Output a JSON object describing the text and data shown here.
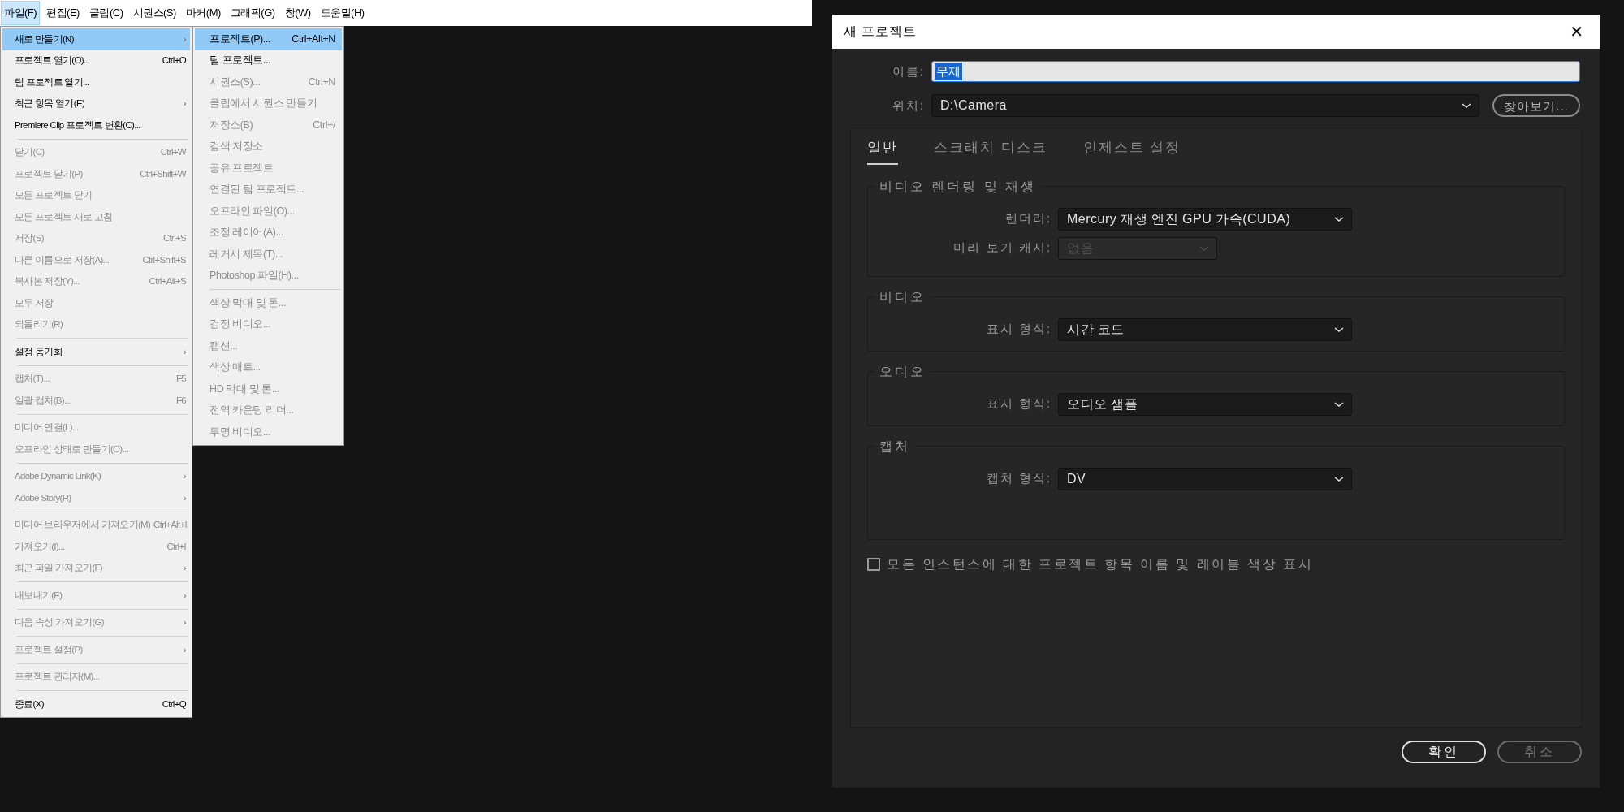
{
  "menu_bar": {
    "items": [
      {
        "label": "파일(F)",
        "selected": true
      },
      {
        "label": "편집(E)",
        "selected": false
      },
      {
        "label": "클립(C)",
        "selected": false
      },
      {
        "label": "시퀀스(S)",
        "selected": false
      },
      {
        "label": "마커(M)",
        "selected": false
      },
      {
        "label": "그래픽(G)",
        "selected": false
      },
      {
        "label": "창(W)",
        "selected": false
      },
      {
        "label": "도움말(H)",
        "selected": false
      }
    ]
  },
  "file_menu": {
    "items": [
      {
        "kind": "item",
        "label": "새로 만들기(N)",
        "arrow": "›",
        "selected": true,
        "disabled": false
      },
      {
        "kind": "item",
        "label": "프로젝트 열기(O)...",
        "shortcut": "Ctrl+O",
        "selected": false,
        "disabled": false
      },
      {
        "kind": "item",
        "label": "팀 프로젝트 열기...",
        "selected": false,
        "disabled": false
      },
      {
        "kind": "item",
        "label": "최근 항목 열기(E)",
        "arrow": "›",
        "selected": false,
        "disabled": false
      },
      {
        "kind": "item",
        "label": "Premiere Clip 프로젝트 변환(C)...",
        "selected": false,
        "disabled": false
      },
      {
        "kind": "separator"
      },
      {
        "kind": "item",
        "label": "닫기(C)",
        "shortcut": "Ctrl+W",
        "selected": false,
        "disabled": true
      },
      {
        "kind": "item",
        "label": "프로젝트 닫기(P)",
        "shortcut": "Ctrl+Shift+W",
        "selected": false,
        "disabled": true
      },
      {
        "kind": "item",
        "label": "모든 프로젝트 닫기",
        "selected": false,
        "disabled": true
      },
      {
        "kind": "item",
        "label": "모든 프로젝트 새로 고침",
        "selected": false,
        "disabled": true
      },
      {
        "kind": "item",
        "label": "저장(S)",
        "shortcut": "Ctrl+S",
        "selected": false,
        "disabled": true
      },
      {
        "kind": "item",
        "label": "다른 이름으로 저장(A)...",
        "shortcut": "Ctrl+Shift+S",
        "selected": false,
        "disabled": true
      },
      {
        "kind": "item",
        "label": "복사본 저장(Y)...",
        "shortcut": "Ctrl+Alt+S",
        "selected": false,
        "disabled": true
      },
      {
        "kind": "item",
        "label": "모두 저장",
        "selected": false,
        "disabled": true
      },
      {
        "kind": "item",
        "label": "되돌리기(R)",
        "selected": false,
        "disabled": true
      },
      {
        "kind": "separator"
      },
      {
        "kind": "item",
        "label": "설정 동기화",
        "arrow": "›",
        "selected": false,
        "disabled": false
      },
      {
        "kind": "separator"
      },
      {
        "kind": "item",
        "label": "캡처(T)...",
        "shortcut": "F5",
        "selected": false,
        "disabled": true
      },
      {
        "kind": "item",
        "label": "일괄 캡처(B)...",
        "shortcut": "F6",
        "selected": false,
        "disabled": true
      },
      {
        "kind": "separator"
      },
      {
        "kind": "item",
        "label": "미디어 연결(L)...",
        "selected": false,
        "disabled": true
      },
      {
        "kind": "item",
        "label": "오프라인 상태로 만들기(O)...",
        "selected": false,
        "disabled": true
      },
      {
        "kind": "separator"
      },
      {
        "kind": "item",
        "label": "Adobe Dynamic Link(K)",
        "arrow": "›",
        "selected": false,
        "disabled": true
      },
      {
        "kind": "item",
        "label": "Adobe Story(R)",
        "arrow": "›",
        "selected": false,
        "disabled": true
      },
      {
        "kind": "separator"
      },
      {
        "kind": "item",
        "label": "미디어 브라우저에서 가져오기(M)",
        "shortcut": "Ctrl+Alt+I",
        "selected": false,
        "disabled": true
      },
      {
        "kind": "item",
        "label": "가져오기(I)...",
        "shortcut": "Ctrl+I",
        "selected": false,
        "disabled": true
      },
      {
        "kind": "item",
        "label": "최근 파일 가져오기(F)",
        "arrow": "›",
        "selected": false,
        "disabled": true
      },
      {
        "kind": "separator"
      },
      {
        "kind": "item",
        "label": "내보내기(E)",
        "arrow": "›",
        "selected": false,
        "disabled": true
      },
      {
        "kind": "separator"
      },
      {
        "kind": "item",
        "label": "다음 속성 가져오기(G)",
        "arrow": "›",
        "selected": false,
        "disabled": true
      },
      {
        "kind": "separator"
      },
      {
        "kind": "item",
        "label": "프로젝트 설정(P)",
        "arrow": "›",
        "selected": false,
        "disabled": true
      },
      {
        "kind": "separator"
      },
      {
        "kind": "item",
        "label": "프로젝트 관리자(M)...",
        "selected": false,
        "disabled": true
      },
      {
        "kind": "separator"
      },
      {
        "kind": "item",
        "label": "종료(X)",
        "shortcut": "Ctrl+Q",
        "selected": false,
        "disabled": false
      }
    ]
  },
  "new_submenu": {
    "items": [
      {
        "kind": "item",
        "label": "프로젝트(P)...",
        "shortcut": "Ctrl+Alt+N",
        "selected": true,
        "disabled": false
      },
      {
        "kind": "item",
        "label": "팀 프로젝트...",
        "selected": false,
        "disabled": false
      },
      {
        "kind": "item",
        "label": "시퀀스(S)...",
        "shortcut": "Ctrl+N",
        "selected": false,
        "disabled": true
      },
      {
        "kind": "item",
        "label": "클립에서 시퀀스 만들기",
        "selected": false,
        "disabled": true
      },
      {
        "kind": "item",
        "label": "저장소(B)",
        "shortcut": "Ctrl+/",
        "selected": false,
        "disabled": true
      },
      {
        "kind": "item",
        "label": "검색 저장소",
        "selected": false,
        "disabled": true
      },
      {
        "kind": "item",
        "label": "공유 프로젝트",
        "selected": false,
        "disabled": true
      },
      {
        "kind": "item",
        "label": "연결된 팀 프로젝트...",
        "selected": false,
        "disabled": true
      },
      {
        "kind": "item",
        "label": "오프라인 파일(O)...",
        "selected": false,
        "disabled": true
      },
      {
        "kind": "item",
        "label": "조정 레이어(A)...",
        "selected": false,
        "disabled": true
      },
      {
        "kind": "item",
        "label": "레거시 제목(T)...",
        "selected": false,
        "disabled": true
      },
      {
        "kind": "item",
        "label": "Photoshop 파일(H)...",
        "selected": false,
        "disabled": true
      },
      {
        "kind": "separator"
      },
      {
        "kind": "item",
        "label": "색상 막대 및 톤...",
        "selected": false,
        "disabled": true
      },
      {
        "kind": "item",
        "label": "검정 비디오...",
        "selected": false,
        "disabled": true
      },
      {
        "kind": "item",
        "label": "캡션...",
        "selected": false,
        "disabled": true
      },
      {
        "kind": "item",
        "label": "색상 매트...",
        "selected": false,
        "disabled": true
      },
      {
        "kind": "item",
        "label": "HD 막대 및 톤...",
        "selected": false,
        "disabled": true
      },
      {
        "kind": "item",
        "label": "전역 카운팅 리더...",
        "selected": false,
        "disabled": true
      },
      {
        "kind": "item",
        "label": "투명 비디오...",
        "selected": false,
        "disabled": true
      }
    ]
  },
  "dialog": {
    "title": "새 프로젝트",
    "close": "✕",
    "name": {
      "label": "이름:",
      "value": "무제",
      "selected": true
    },
    "location": {
      "label": "위치:",
      "value": "D:\\Camera"
    },
    "browse_button": "찾아보기...",
    "tabs": [
      {
        "label": "일반",
        "selected": true
      },
      {
        "label": "스크래치 디스크",
        "selected": false
      },
      {
        "label": "인제스트 설정",
        "selected": false
      }
    ],
    "groups": [
      {
        "title": "비디오 렌더링 및 재생",
        "fields": [
          {
            "label": "렌더러:",
            "value": "Mercury 재생 엔진 GPU 가속(CUDA)",
            "disabled": false
          },
          {
            "label": "미리 보기 캐시:",
            "value": "없음",
            "disabled": true
          }
        ]
      },
      {
        "title": "비디오",
        "fields": [
          {
            "label": "표시 형식:",
            "value": "시간 코드",
            "disabled": false
          }
        ]
      },
      {
        "title": "오디오",
        "fields": [
          {
            "label": "표시 형식:",
            "value": "오디오 샘플",
            "disabled": false
          }
        ]
      },
      {
        "title": "캡처",
        "fields": [
          {
            "label": "캡처 형식:",
            "value": "DV",
            "disabled": false
          }
        ]
      }
    ],
    "checkbox": {
      "label": "모든 인스턴스에 대한 프로젝트 항목 이름 및 레이블 색상 표시",
      "checked": false
    },
    "buttons": [
      {
        "label": "확인",
        "kind": "primary"
      },
      {
        "label": "취소",
        "kind": "secondary"
      }
    ]
  }
}
